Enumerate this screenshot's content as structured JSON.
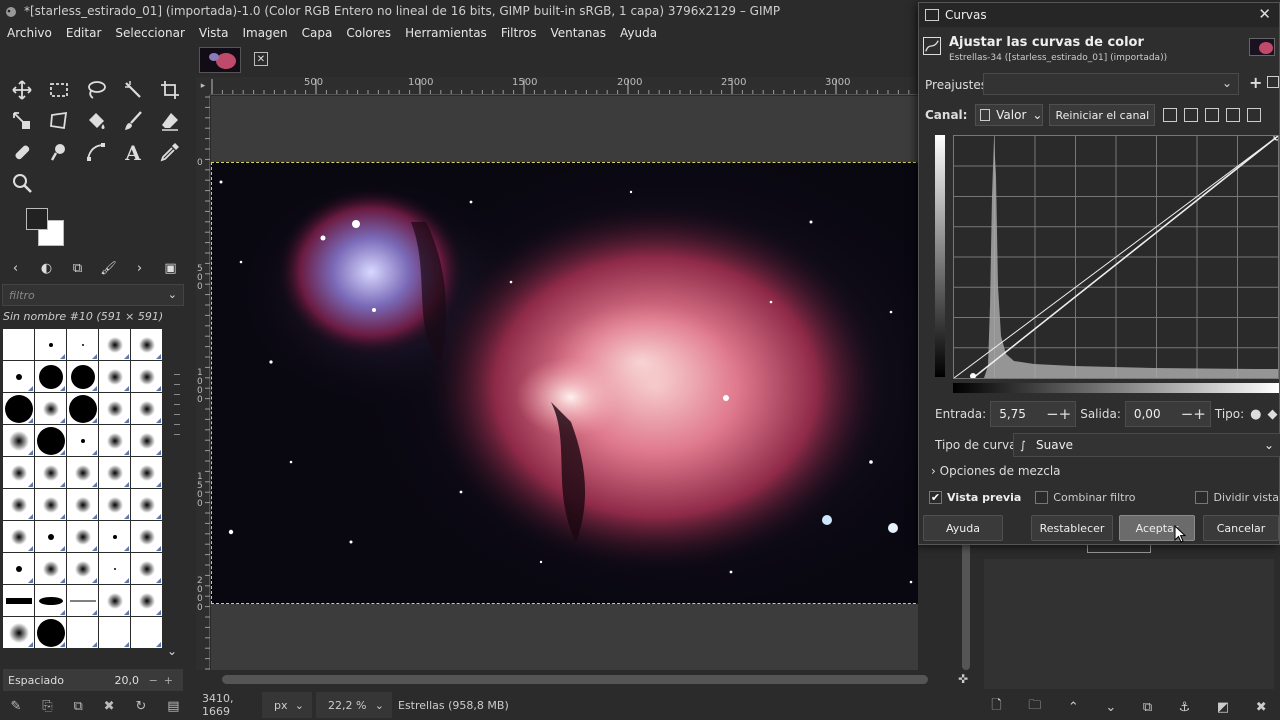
{
  "window": {
    "title": "*[starless_estirado_01] (importada)-1.0 (Color RGB Entero no lineal de 16 bits, GIMP built-in sRGB, 1 capa) 3796x2129 – GIMP"
  },
  "menu": [
    "Archivo",
    "Editar",
    "Seleccionar",
    "Vista",
    "Imagen",
    "Capa",
    "Colores",
    "Herramientas",
    "Filtros",
    "Ventanas",
    "Ayuda"
  ],
  "toolbox": {
    "filter_placeholder": "filtro",
    "brush_name": "Sin nombre #10 (591 × 591)",
    "spacing_label": "Espaciado",
    "spacing_value": "20,0"
  },
  "ruler": {
    "h_labels": [
      "500",
      "1000",
      "1500",
      "2000",
      "2500",
      "3000"
    ],
    "v_labels": [
      "0",
      "5\n0\n0",
      "1\n0\n0\n0",
      "1\n5\n0\n0",
      "2\n0\n0\n0"
    ]
  },
  "status": {
    "coords": "3410, 1669",
    "unit": "px",
    "zoom": "22,2 %",
    "info": "Estrellas (958,8 MB)"
  },
  "curves": {
    "dialog_title": "Curvas",
    "heading": "Ajustar las curvas de color",
    "subheading": "Estrellas-34 ([starless_estirado_01] (importada))",
    "presets_label": "Preajustes:",
    "channel_label": "Canal:",
    "channel_value": "Valor",
    "reset_channel": "Reiniciar el canal",
    "input_label": "Entrada:",
    "input_value": "5,75",
    "output_label": "Salida:",
    "output_value": "0,00",
    "type_label": "Tipo:",
    "curve_type_label": "Tipo de curva:",
    "curve_type_value": "Suave",
    "blend_options": "Opciones de mezcla",
    "preview_label": "Vista previa",
    "combine_label": "Combinar filtro",
    "split_label": "Dividir vista",
    "buttons": {
      "help": "Ayuda",
      "reset": "Restablecer",
      "ok": "Aceptar",
      "cancel": "Cancelar"
    }
  }
}
